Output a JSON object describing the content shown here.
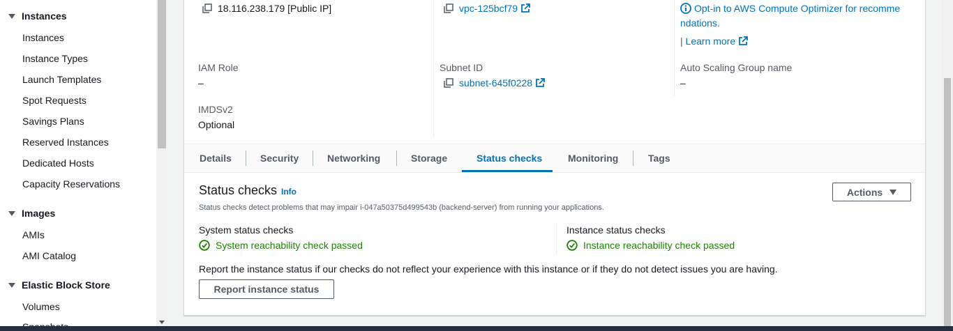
{
  "sidebar": {
    "sections": [
      {
        "title": "Instances",
        "items": [
          "Instances",
          "Instance Types",
          "Launch Templates",
          "Spot Requests",
          "Savings Plans",
          "Reserved Instances",
          "Dedicated Hosts",
          "Capacity Reservations"
        ]
      },
      {
        "title": "Images",
        "items": [
          "AMIs",
          "AMI Catalog"
        ]
      },
      {
        "title": "Elastic Block Store",
        "items": [
          "Volumes",
          "Snapshots"
        ]
      }
    ]
  },
  "details": {
    "public_ip": "18.116.238.179 [Public IP]",
    "vpc_id": "vpc-125bcf79",
    "optimizer_link_line1": "Opt-in to AWS Compute Optimizer for recomme",
    "optimizer_link_line2": "ndations.",
    "learn_more_prefix": "|",
    "learn_more": "Learn more",
    "iam_role_label": "IAM Role",
    "iam_role_value": "–",
    "subnet_label": "Subnet ID",
    "subnet_value": "subnet-645f0228",
    "asg_label": "Auto Scaling Group name",
    "asg_value": "–",
    "imds_label": "IMDSv2",
    "imds_value": "Optional"
  },
  "tabs": [
    "Details",
    "Security",
    "Networking",
    "Storage",
    "Status checks",
    "Monitoring",
    "Tags"
  ],
  "active_tab": "Status checks",
  "status_checks": {
    "title": "Status checks",
    "info": "Info",
    "actions_label": "Actions",
    "description": "Status checks detect problems that may impair i-047a50375d499543b (backend-server) from running your applications.",
    "system_label": "System status checks",
    "system_result": "System reachability check passed",
    "instance_label": "Instance status checks",
    "instance_result": "Instance reachability check passed",
    "report_text": "Report the instance status if our checks do not reflect your experience with this instance or if they do not detect issues you are having.",
    "report_button": "Report instance status"
  },
  "colors": {
    "link": "#0073bb",
    "success": "#1d8102",
    "nav_dark": "#232f3e"
  }
}
